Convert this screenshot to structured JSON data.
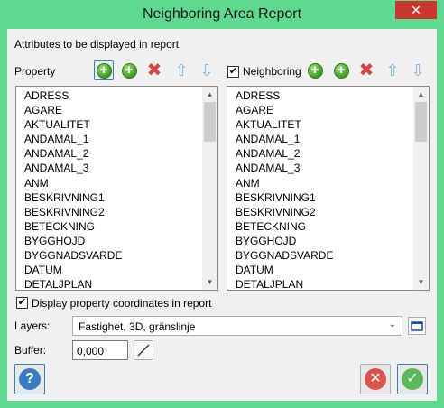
{
  "window": {
    "title": "Neighboring Area Report",
    "close_glyph": "✕"
  },
  "section_label": "Attributes to be displayed in report",
  "property_panel": {
    "label": "Property",
    "items": [
      "ADRESS",
      "AGARE",
      "AKTUALITET",
      "ANDAMAL_1",
      "ANDAMAL_2",
      "ANDAMAL_3",
      "ANM",
      "BESKRIVNING1",
      "BESKRIVNING2",
      "BETECKNING",
      "BYGGHÖJD",
      "BYGGNADSVARDE",
      "DATUM",
      "DETALJPLAN"
    ]
  },
  "neighboring_panel": {
    "label": "Neighboring",
    "checked": true,
    "items": [
      "ADRESS",
      "AGARE",
      "AKTUALITET",
      "ANDAMAL_1",
      "ANDAMAL_2",
      "ANDAMAL_3",
      "ANM",
      "BESKRIVNING1",
      "BESKRIVNING2",
      "BETECKNING",
      "BYGGHÖJD",
      "BYGGNADSVARDE",
      "DATUM",
      "DETALJPLAN"
    ]
  },
  "toolbar_icons": [
    "add-icon",
    "add-all-icon",
    "remove-icon",
    "move-up-icon",
    "move-down-icon"
  ],
  "display_coords": {
    "label": "Display property coordinates in report",
    "checked": true
  },
  "layers": {
    "label": "Layers:",
    "value": "Fastighet, 3D, gränslinje"
  },
  "buffer": {
    "label": "Buffer:",
    "value": "0,000"
  },
  "colors": {
    "titlebar": "#5fd98f",
    "close": "#c7372f",
    "cancel": "#d9534f",
    "ok": "#5cb85c",
    "help": "#3a7cc4"
  }
}
